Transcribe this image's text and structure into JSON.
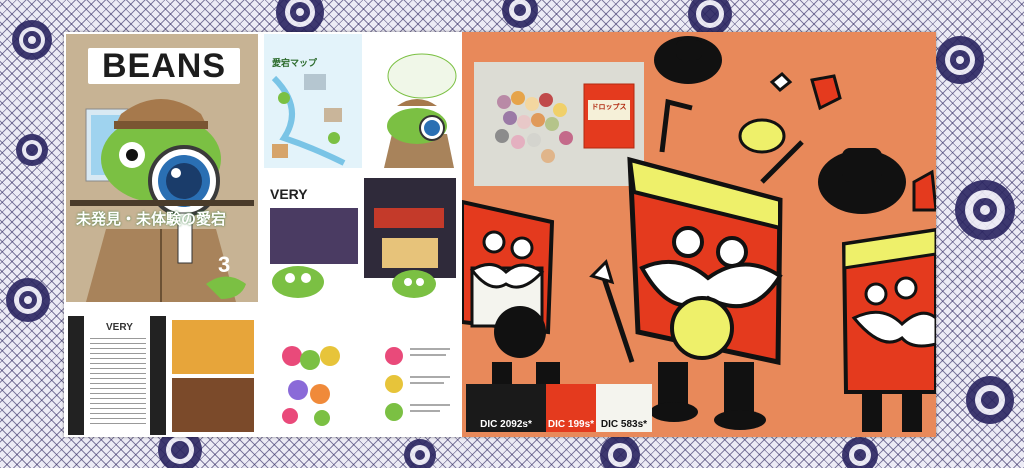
{
  "colors": {
    "pattern_ink": "#28205a",
    "pattern_bg": "#ecebf5",
    "cover_bg": "#c7b394",
    "character_green": "#7bc043",
    "sheet_orange": "#e8895a",
    "tin_red": "#e43a1e",
    "tin_yellow": "#eef06a",
    "dic_2092": "#1a1a1a",
    "dic_199": "#e43a1e",
    "dic_583": "#f4f4ee"
  },
  "magazine": {
    "masthead": "BEANS",
    "cover_headline": "未発見・未体験の愛宕",
    "issue_number": "3",
    "map_spread_title": "愛宕マップ",
    "very_spread_title": "VERY",
    "very_list_title": "VERY"
  },
  "character_sheet": {
    "swatches": [
      {
        "label": "DIC 2092s*",
        "color": "#1a1a1a"
      },
      {
        "label": "DIC 199s*",
        "color": "#e43a1e"
      },
      {
        "label": "DIC 583s*",
        "color": "#f4f4ee"
      }
    ],
    "photo_tin_label": "ドロップス"
  }
}
